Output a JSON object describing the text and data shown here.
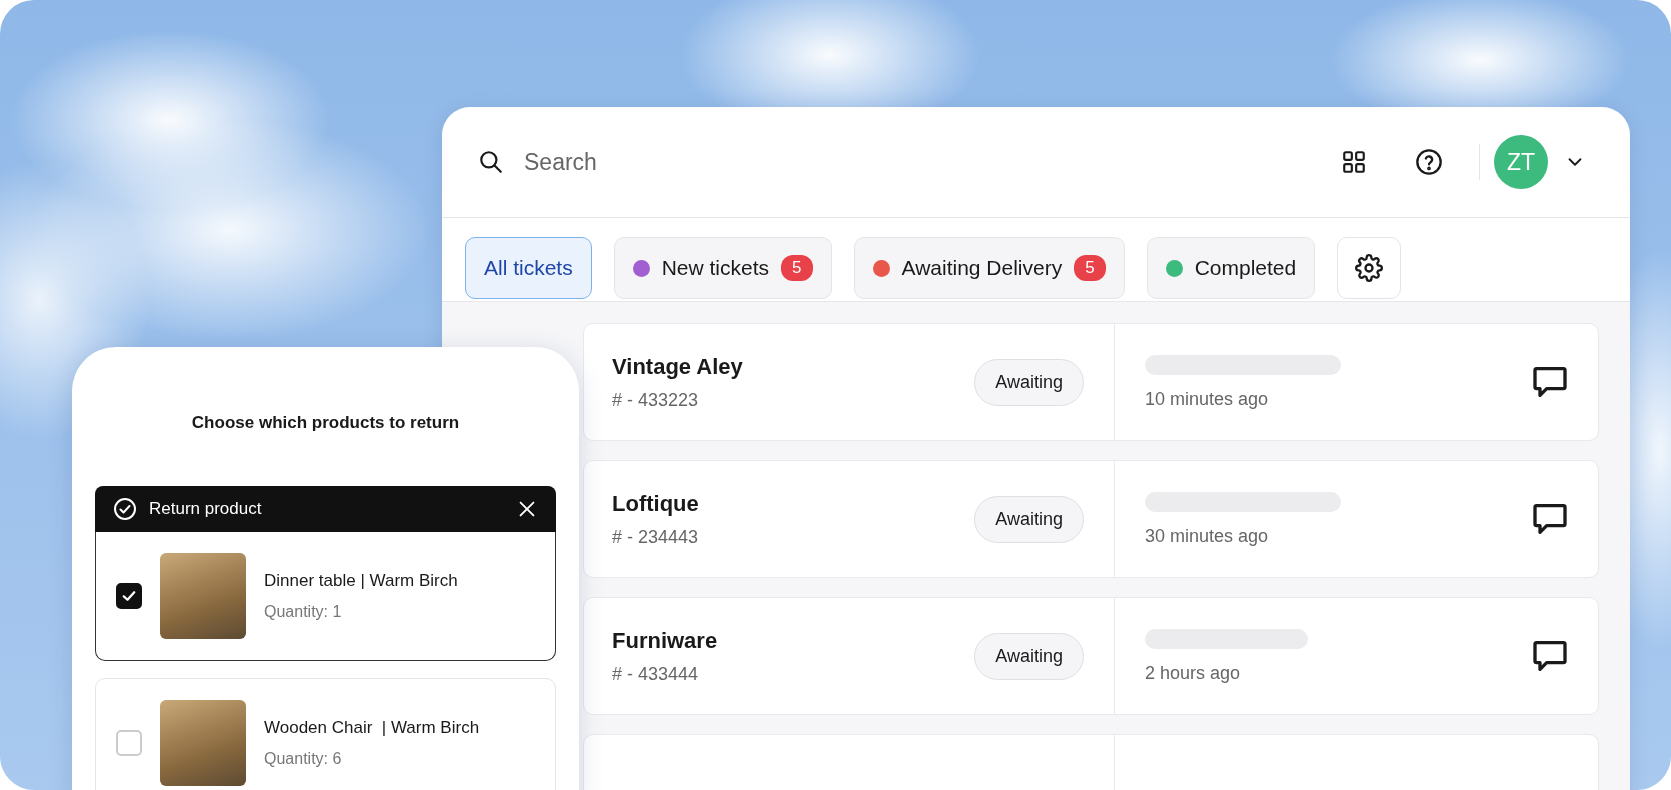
{
  "search": {
    "placeholder": "Search"
  },
  "user": {
    "initials": "ZT"
  },
  "filters": [
    {
      "label": "All tickets",
      "selected": true
    },
    {
      "label": "New tickets",
      "color": "#a15fd1",
      "count": "5",
      "selected": false
    },
    {
      "label": "Awaiting Delivery",
      "color": "#e8574a",
      "count": "5",
      "selected": false
    },
    {
      "label": "Completed",
      "color": "#3dbb7f",
      "selected": false
    }
  ],
  "tickets": [
    {
      "name": "Vintage Aley",
      "number": "# - 433223",
      "status": "Awaiting",
      "time": "10 minutes ago"
    },
    {
      "name": "Loftique",
      "number": "# - 234443",
      "status": "Awaiting",
      "time": "30 minutes ago"
    },
    {
      "name": "Furniware",
      "number": "# - 433444",
      "status": "Awaiting",
      "time": "2 hours ago"
    }
  ],
  "return_dialog": {
    "title": "Choose which products to return",
    "banner": "Return product",
    "products": [
      {
        "name": "Dinner table | Warm Birch",
        "quantity": "Quantity: 1",
        "checked": true
      },
      {
        "name": "Wooden Chair  | Warm Birch",
        "quantity": "Quantity: 6",
        "checked": false
      }
    ]
  }
}
